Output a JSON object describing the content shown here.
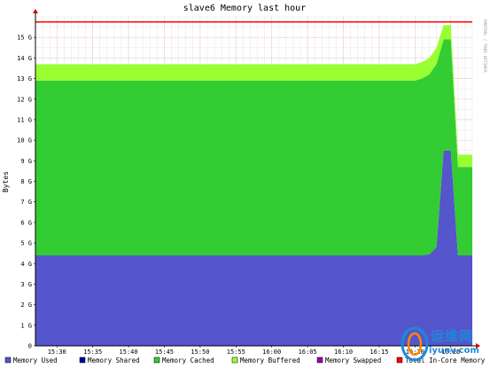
{
  "chart_data": {
    "type": "area",
    "title": "slave6 Memory last hour",
    "ylabel": "Bytes",
    "xlabel": "",
    "side_text": "RRDTOOL / TOBI OETIKER",
    "ylim": [
      0,
      16
    ],
    "y_unit": "G",
    "y_ticks": [
      0,
      1,
      2,
      3,
      4,
      5,
      6,
      7,
      8,
      9,
      10,
      11,
      12,
      13,
      14,
      15
    ],
    "y_tick_labels": [
      "0",
      "1 G",
      "2 G",
      "3 G",
      "4 G",
      "5 G",
      "6 G",
      "7 G",
      "8 G",
      "9 G",
      "10 G",
      "11 G",
      "12 G",
      "13 G",
      "14 G",
      "15 G"
    ],
    "x_range": [
      "15:27",
      "16:28"
    ],
    "x_ticks": [
      "15:30",
      "15:35",
      "15:40",
      "15:45",
      "15:50",
      "15:55",
      "16:00",
      "16:05",
      "16:10",
      "16:15",
      "16:20",
      "16:25"
    ],
    "x": [
      "15:27",
      "15:35",
      "15:45",
      "15:55",
      "16:05",
      "16:15",
      "16:20",
      "16:21",
      "16:22",
      "16:23",
      "16:24",
      "16:25",
      "16:26",
      "16:27",
      "16:28"
    ],
    "stacked": true,
    "grid": true,
    "series": [
      {
        "name": "Memory Used",
        "color": "#5555cc",
        "values": [
          4.4,
          4.4,
          4.4,
          4.4,
          4.4,
          4.4,
          4.4,
          4.4,
          4.45,
          4.8,
          9.5,
          9.5,
          4.4,
          4.4,
          4.4
        ]
      },
      {
        "name": "Memory Shared",
        "color": "#0000a0",
        "values": [
          0,
          0,
          0,
          0,
          0,
          0,
          0,
          0,
          0,
          0,
          0,
          0,
          0,
          0,
          0
        ]
      },
      {
        "name": "Memory Cached",
        "color": "#33cc33",
        "values": [
          8.5,
          8.5,
          8.5,
          8.5,
          8.5,
          8.5,
          8.5,
          8.6,
          8.75,
          8.9,
          5.4,
          5.4,
          4.3,
          4.3,
          4.3
        ]
      },
      {
        "name": "Memory Buffered",
        "color": "#99ff33",
        "values": [
          0.8,
          0.8,
          0.8,
          0.8,
          0.8,
          0.8,
          0.8,
          0.8,
          0.8,
          0.8,
          0.7,
          0.7,
          0.6,
          0.6,
          0.6
        ]
      },
      {
        "name": "Memory Swapped",
        "color": "#9900aa",
        "values": [
          0,
          0,
          0,
          0,
          0,
          0,
          0,
          0,
          0,
          0,
          0,
          0,
          0,
          0,
          0
        ]
      }
    ],
    "reference_line": {
      "name": "Total In-Core Memory",
      "color": "#ff0000",
      "value": 15.75
    },
    "legend_position": "bottom"
  },
  "watermark": {
    "text": "运维网",
    "sub": "iyunv.com"
  }
}
